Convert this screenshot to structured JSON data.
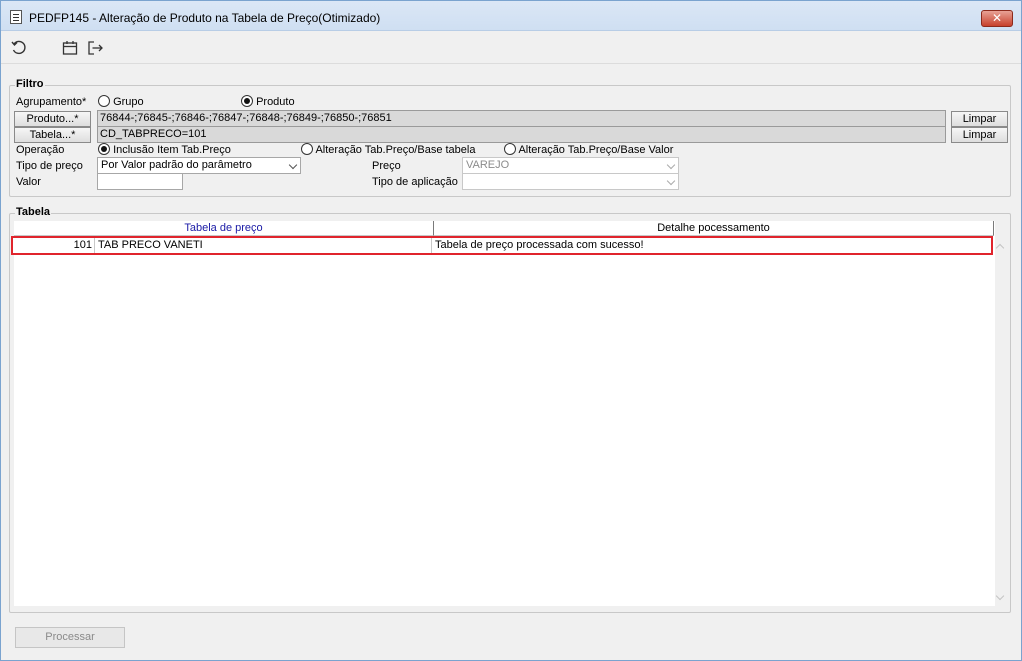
{
  "window": {
    "title": "PEDFP145 - Alteração de Produto na Tabela de Preço(Otimizado)",
    "close_label": "✕"
  },
  "toolbar": {
    "icons": [
      "refresh-icon",
      "calendar-icon",
      "exit-icon"
    ]
  },
  "filtro": {
    "legend": "Filtro",
    "agrupamento": {
      "label": "Agrupamento*",
      "options": [
        "Grupo",
        "Produto"
      ],
      "selected": "Produto"
    },
    "produto": {
      "button_label": "Produto...*",
      "value": "76844-;76845-;76846-;76847-;76848-;76849-;76850-;76851",
      "clear_label": "Limpar"
    },
    "tabela": {
      "button_label": "Tabela...*",
      "value": "CD_TABPRECO=101",
      "clear_label": "Limpar"
    },
    "operacao": {
      "label": "Operação",
      "options": [
        "Inclusão Item Tab.Preço",
        "Alteração Tab.Preço/Base tabela",
        "Alteração Tab.Preço/Base Valor"
      ],
      "selected": "Inclusão Item Tab.Preço"
    },
    "tipo_preco": {
      "label": "Tipo de preço",
      "value": "Por Valor padrão do parâmetro"
    },
    "preco": {
      "label": "Preço",
      "value": "VAREJO"
    },
    "valor": {
      "label": "Valor",
      "value": ""
    },
    "tipo_aplicacao": {
      "label": "Tipo de aplicação",
      "value": ""
    }
  },
  "tabela": {
    "legend": "Tabela",
    "columns": [
      "Tabela de preço",
      "Detalhe pocessamento"
    ],
    "rows": [
      {
        "code": "101",
        "name": "TAB PRECO VANETI",
        "detail": "Tabela de preço processada com sucesso!"
      }
    ]
  },
  "footer": {
    "process_label": "Processar"
  }
}
